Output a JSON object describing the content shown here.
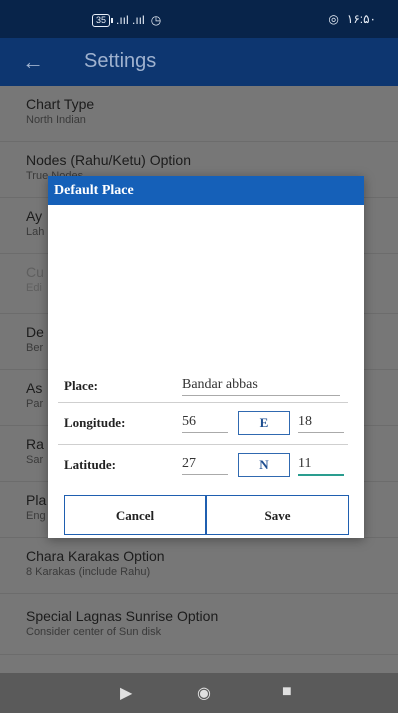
{
  "status_bar": {
    "battery": "35",
    "time": "۱۶:۵۰"
  },
  "app_bar": {
    "back_glyph": "←",
    "title": "Settings"
  },
  "settings": [
    {
      "title": "Chart Type",
      "subtitle": "North Indian"
    },
    {
      "title": "Nodes (Rahu/Ketu) Option",
      "subtitle": "True Nodes"
    },
    {
      "title": "Ay",
      "subtitle": "Lah"
    },
    {
      "title": "Cu",
      "subtitle": "Edi"
    },
    {
      "title": "De",
      "subtitle": "Ber"
    },
    {
      "title": "As",
      "subtitle": "Par"
    },
    {
      "title": "Ra",
      "subtitle": "Sar"
    },
    {
      "title": "Pla",
      "subtitle": "Eng"
    },
    {
      "title": "Chara Karakas Option",
      "subtitle": "8 Karakas (include Rahu)"
    },
    {
      "title": "Special Lagnas Sunrise Option",
      "subtitle": "Consider center of Sun disk"
    }
  ],
  "dialog": {
    "title": "Default Place",
    "place_label": "Place:",
    "place_value": "Bandar abbas",
    "longitude_label": "Longitude:",
    "longitude_deg": "56",
    "longitude_dir": "E",
    "longitude_min": "18",
    "latitude_label": "Latitude:",
    "latitude_deg": "27",
    "latitude_dir": "N",
    "latitude_min": "11",
    "cancel_label": "Cancel",
    "save_label": "Save"
  },
  "nav": {
    "back_glyph": "▶",
    "home_glyph": "◉",
    "recents_glyph": "■"
  },
  "colors": {
    "status_bar": "#08244a",
    "app_bar": "#0d3670",
    "dialog_header": "#1560b8",
    "accent_line": "#2a9d8f"
  }
}
